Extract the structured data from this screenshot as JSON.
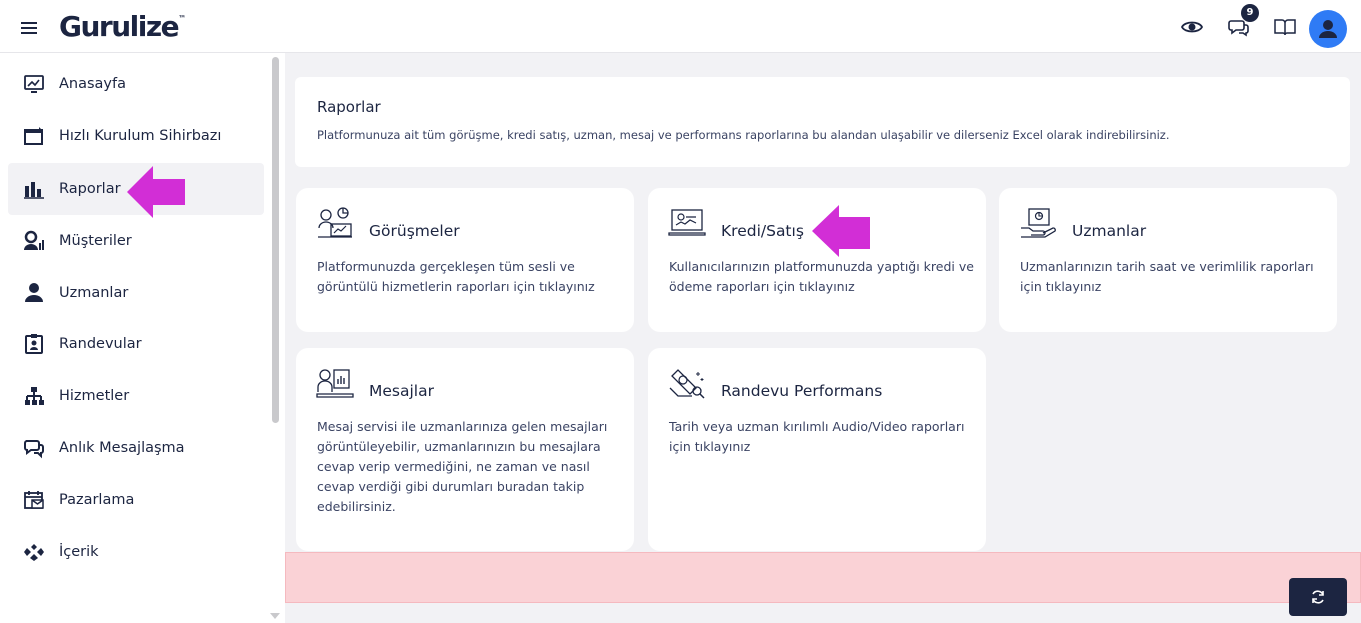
{
  "header": {
    "logo_text": "Gurulize",
    "logo_mark": "™",
    "notification_count": "9",
    "icons": [
      "eye-icon",
      "chat-icon",
      "book-icon",
      "user-avatar-icon"
    ]
  },
  "sidebar": {
    "items": [
      {
        "label": "Anasayfa",
        "icon": "monitor-chart-icon"
      },
      {
        "label": "Hızlı Kurulum Sihirbazı",
        "icon": "wizard-window-icon"
      },
      {
        "label": "Raporlar",
        "icon": "bar-chart-icon",
        "active": true
      },
      {
        "label": "Müşteriler",
        "icon": "customer-chart-icon"
      },
      {
        "label": "Uzmanlar",
        "icon": "person-icon"
      },
      {
        "label": "Randevular",
        "icon": "clipboard-user-icon"
      },
      {
        "label": "Hizmetler",
        "icon": "sitemap-icon"
      },
      {
        "label": "Anlık Mesajlaşma",
        "icon": "chat-bubbles-icon"
      },
      {
        "label": "Pazarlama",
        "icon": "calendar-mail-icon"
      },
      {
        "label": "İçerik",
        "icon": "content-icon"
      }
    ]
  },
  "intro": {
    "title": "Raporlar",
    "description": "Platformunuza ait tüm görüşme, kredi satış, uzman, mesaj ve performans raporlarına bu alandan ulaşabilir ve dilerseniz Excel olarak indirebilirsiniz."
  },
  "cards": [
    {
      "title": "Görüşmeler",
      "description": "Platformunuzda gerçekleşen tüm sesli ve görüntülü hizmetlerin raporları için tıklayınız",
      "icon": "meeting-users-icon"
    },
    {
      "title": "Kredi/Satış",
      "description": "Kullanıcılarınızın platformunuzda yaptığı kredi ve ödeme raporları için tıklayınız",
      "icon": "credit-report-icon"
    },
    {
      "title": "Uzmanlar",
      "description": "Uzmanlarınızın tarih saat ve verimlilik raporları için tıklayınız",
      "icon": "expert-report-icon"
    },
    {
      "title": "Mesajlar",
      "description": "Mesaj servisi ile uzmanlarınıza gelen mesajları görüntüleyebilir, uzmanlarınızın bu mesajlara cevap verip vermediğini, ne zaman ve nasıl cevap verdiği gibi durumları buradan takip edebilirsiniz.",
      "icon": "message-report-icon"
    },
    {
      "title": "Randevu Performans",
      "description": "Tarih veya uzman kırılımlı Audio/Video raporları için tıklayınız",
      "icon": "performance-search-icon"
    }
  ],
  "colors": {
    "accent_arrow": "#d22ed6",
    "primary": "#1c2541",
    "avatar": "#2f7bf5",
    "alert_bg": "#fad2d6"
  }
}
